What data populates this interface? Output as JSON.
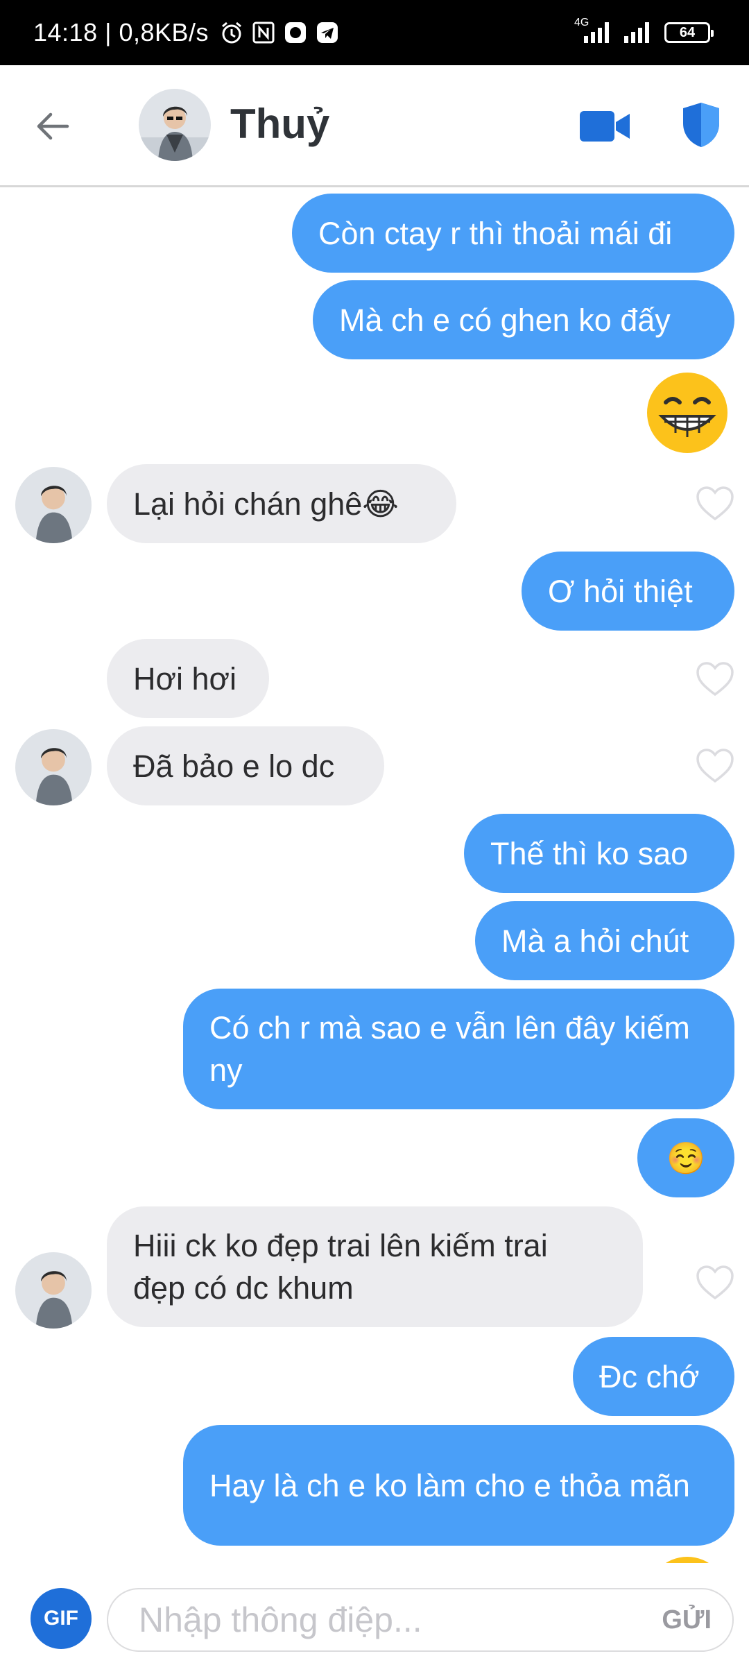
{
  "status_bar": {
    "time_and_speed": "14:18 | 0,8KB/s",
    "network": "4G",
    "battery": "64"
  },
  "header": {
    "contact_name": "Thuỷ"
  },
  "messages": [
    {
      "side": "sent",
      "text": "Còn ctay r thì thoải mái đi"
    },
    {
      "side": "sent",
      "text": "Mà ch e có ghen ko đấy"
    },
    {
      "side": "sent",
      "emoji": "grinning-face"
    },
    {
      "side": "received",
      "text": "Lại hỏi chán ghê😂"
    },
    {
      "side": "sent",
      "text": "Ơ hỏi thiệt"
    },
    {
      "side": "received",
      "text": "Hơi hơi"
    },
    {
      "side": "received",
      "text": "Đã bảo e lo dc"
    },
    {
      "side": "sent",
      "text": "Thế thì ko sao"
    },
    {
      "side": "sent",
      "text": "Mà a hỏi chút"
    },
    {
      "side": "sent",
      "text": "Có ch r mà sao e vẫn lên đây kiếm ny"
    },
    {
      "side": "sent",
      "text": "☺️"
    },
    {
      "side": "received",
      "text": "Hiii ck ko đẹp trai lên kiếm trai đẹp có dc khum"
    },
    {
      "side": "sent",
      "text": "Đc chớ"
    },
    {
      "side": "sent",
      "text": "Hay là ch e ko làm cho e thỏa mãn"
    }
  ],
  "composer": {
    "gif_label": "GIF",
    "placeholder": "Nhập thông điệp...",
    "send_label": "GỬI"
  },
  "colors": {
    "sent_bubble": "#4a9ff8",
    "received_bubble": "#ececef",
    "accent": "#1f6fd9"
  }
}
